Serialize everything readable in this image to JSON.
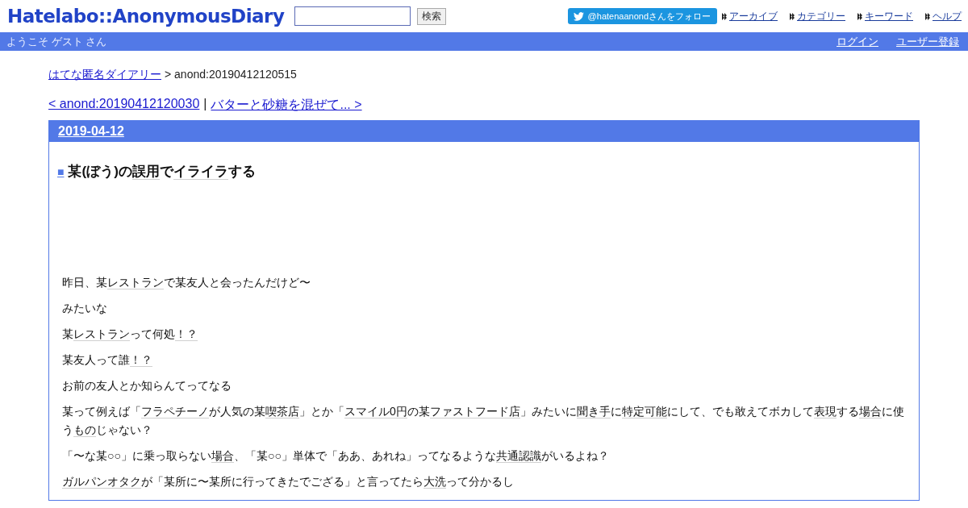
{
  "header": {
    "logo": "Hatelabo::AnonymousDiary",
    "search": {
      "button": "検索"
    },
    "follow": "@hatenaanondさんをフォロー",
    "links": [
      "アーカイブ",
      "カテゴリー",
      "キーワード",
      "ヘルプ"
    ]
  },
  "userbar": {
    "welcome": "ようこそ ゲスト さん",
    "links": [
      "ログイン",
      "ユーザー登録"
    ]
  },
  "breadcrumb": {
    "link": "はてな匿名ダイアリー",
    "current": "> anond:20190412120515"
  },
  "pager": {
    "prev": "< anond:20190412120030",
    "separator": "|",
    "next": "バターと砂糖を混ぜて... >"
  },
  "day": {
    "date": "2019-04-12",
    "mark": "■",
    "title": [
      {
        "text": "某(ぼう)の",
        "keyword": false
      },
      {
        "text": "誤用",
        "keyword": true
      },
      {
        "text": "で",
        "keyword": false
      },
      {
        "text": "イライラ",
        "keyword": true
      },
      {
        "text": "する",
        "keyword": false
      }
    ],
    "paragraphs": [
      [
        {
          "text": "昨日、某",
          "keyword": false
        },
        {
          "text": "レストラン",
          "keyword": true
        },
        {
          "text": "で某友人と会ったんだけど〜",
          "keyword": false
        }
      ],
      [
        {
          "text": "みたいな",
          "keyword": false
        }
      ],
      [
        {
          "text": "某",
          "keyword": false
        },
        {
          "text": "レストラン",
          "keyword": true
        },
        {
          "text": "って何処",
          "keyword": false
        },
        {
          "text": "！？",
          "keyword": true
        }
      ],
      [
        {
          "text": "某友人って誰",
          "keyword": false
        },
        {
          "text": "！？",
          "keyword": true
        }
      ],
      [
        {
          "text": "お前の友人とか知らんてってなる",
          "keyword": false
        }
      ],
      [
        {
          "text": "某って例えば「",
          "keyword": false
        },
        {
          "text": "フラペチーノ",
          "keyword": true
        },
        {
          "text": "が人気の某",
          "keyword": false
        },
        {
          "text": "喫茶店",
          "keyword": true
        },
        {
          "text": "」とか「",
          "keyword": false
        },
        {
          "text": "スマイル0円",
          "keyword": true
        },
        {
          "text": "の某",
          "keyword": false
        },
        {
          "text": "ファストフード店",
          "keyword": true
        },
        {
          "text": "」みたいに",
          "keyword": false
        },
        {
          "text": "聞き手",
          "keyword": true
        },
        {
          "text": "に",
          "keyword": false
        },
        {
          "text": "特定可能",
          "keyword": true
        },
        {
          "text": "にして、でも敢えてボカして",
          "keyword": false
        },
        {
          "text": "表現",
          "keyword": true
        },
        {
          "text": "する",
          "keyword": false
        },
        {
          "text": "場合",
          "keyword": true
        },
        {
          "text": "に使う",
          "keyword": false
        },
        {
          "text": "もの",
          "keyword": true
        },
        {
          "text": "じゃない？",
          "keyword": false
        }
      ],
      [
        {
          "text": "「〜な某○○」に乗っ取らない",
          "keyword": false
        },
        {
          "text": "場合",
          "keyword": true
        },
        {
          "text": "、「某○○」単体で「ああ、あれね」ってなるような",
          "keyword": false
        },
        {
          "text": "共通認識",
          "keyword": true
        },
        {
          "text": "がいるよね？",
          "keyword": false
        }
      ],
      [
        {
          "text": "ガルパンオタク",
          "keyword": true
        },
        {
          "text": "が「某所に〜某所に行ってきたでござる」と言ってたら",
          "keyword": false
        },
        {
          "text": "大洗",
          "keyword": true
        },
        {
          "text": "って分かるし",
          "keyword": false
        }
      ]
    ]
  }
}
